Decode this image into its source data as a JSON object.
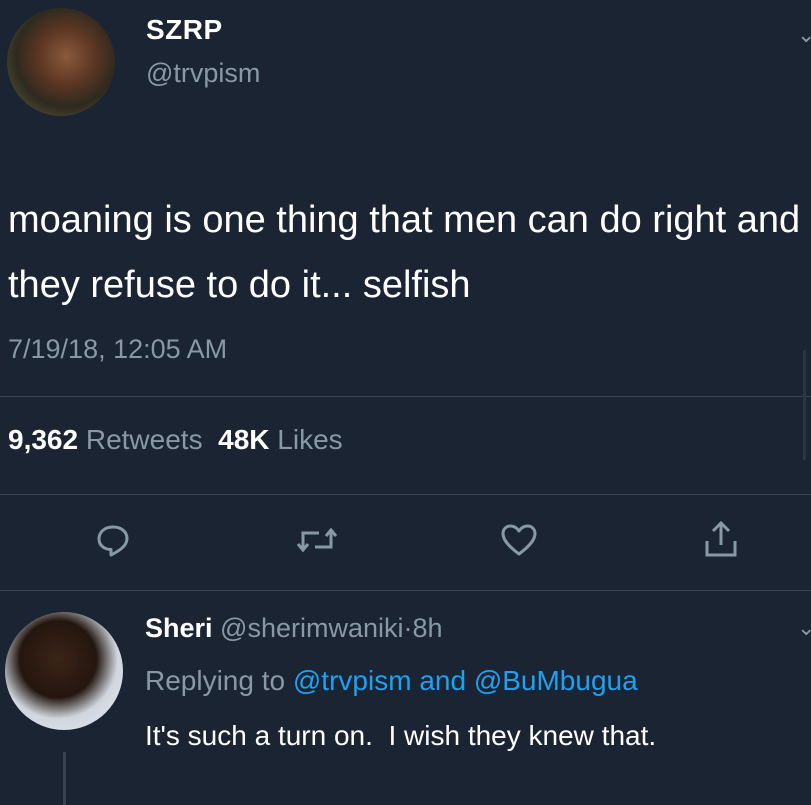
{
  "tweet": {
    "author_name": "SZRP",
    "author_handle": "@trvpism",
    "text": "moaning is one thing that men can do right and they refuse to do it... selfish",
    "timestamp": "7/19/18, 12:05 AM",
    "retweets_count": "9,362",
    "retweets_label": "Retweets",
    "likes_count": "48K",
    "likes_label": "Likes",
    "actions": [
      "reply-icon",
      "retweet-icon",
      "like-icon",
      "share-icon"
    ]
  },
  "reply": {
    "author_name": "Sheri",
    "author_handle": "@sherimwaniki",
    "separator": "·",
    "time": "8h",
    "replying_prefix": "Replying to",
    "replying_to_1": "@trvpism",
    "replying_and": "and",
    "replying_to_2": "@BuMbugua",
    "text": "It's such a turn on.  I wish they knew that."
  },
  "colors": {
    "background": "#1b2432",
    "secondary_text": "#8899a6",
    "link": "#1da1f2",
    "divider": "#38444d"
  }
}
